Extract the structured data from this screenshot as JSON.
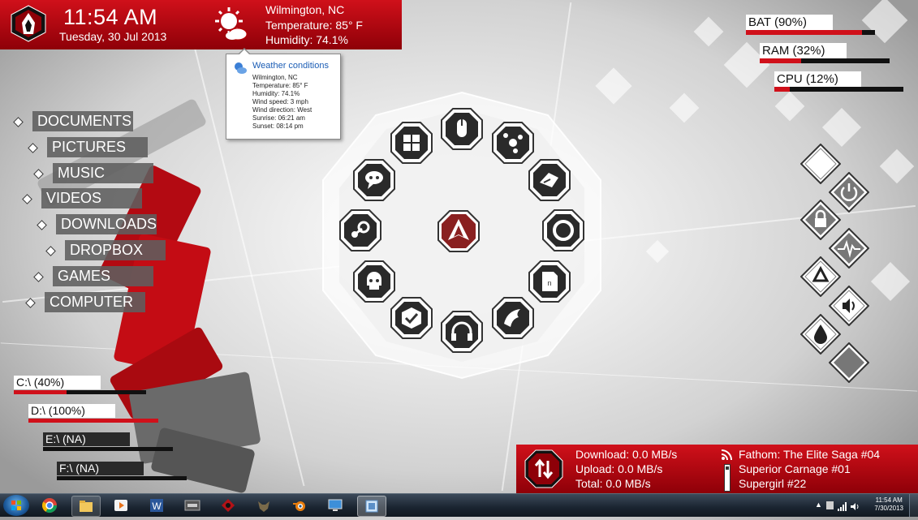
{
  "clock": {
    "time": "11:54 AM",
    "date": "Tuesday, 30 Jul 2013"
  },
  "weather": {
    "location": "Wilmington, NC",
    "temperature": "Temperature: 85° F",
    "humidity": "Humidity: 74.1%",
    "icon": "sun-cloud-icon"
  },
  "tooltip": {
    "title": "Weather conditions",
    "lines": [
      "Wilmington, NC",
      "Temperature: 85° F",
      "Humidity: 74.1%",
      "Wind speed: 3 mph",
      "Wind direction: West",
      "Sunrise: 06:21 am",
      "Sunset: 08:14 pm"
    ]
  },
  "menu": {
    "items": [
      {
        "label": "DOCUMENTS"
      },
      {
        "label": "PICTURES"
      },
      {
        "label": "MUSIC"
      },
      {
        "label": "VIDEOS"
      },
      {
        "label": "DOWNLOADS"
      },
      {
        "label": "DROPBOX"
      },
      {
        "label": "GAMES"
      },
      {
        "label": "COMPUTER"
      }
    ]
  },
  "drives": [
    {
      "label": "C:\\  (40%)",
      "fill": 0.4
    },
    {
      "label": "D:\\  (100%)",
      "fill": 1.0
    },
    {
      "label": "E:\\  (NA)",
      "fill": 0
    },
    {
      "label": "F:\\  (NA)",
      "fill": 0
    }
  ],
  "system": [
    {
      "label": "BAT (90%)",
      "fill": 0.9
    },
    {
      "label": "RAM (32%)",
      "fill": 0.32
    },
    {
      "label": "CPU (12%)",
      "fill": 0.12
    }
  ],
  "launcher": {
    "center_icon": "assassins-logo-icon",
    "items": [
      "mouse-icon",
      "share-icon",
      "hands-icon",
      "origin-icon",
      "document-icon",
      "eagle-icon",
      "headphones-icon",
      "check-icon",
      "skull-icon",
      "steam-icon",
      "skull-chat-icon",
      "apps-icon"
    ]
  },
  "power": {
    "items": [
      "blank-icon",
      "power-icon",
      "lock-icon",
      "pulse-icon",
      "recycle-icon",
      "volume-icon",
      "drop-icon",
      "blank-icon"
    ]
  },
  "network": {
    "download": "Download: 0.0 MB/s",
    "upload": "Upload: 0.0 MB/s",
    "total": "Total: 0.0 MB/s"
  },
  "feeds": [
    "Fathom: The Elite Saga #04",
    "Superior Carnage #01",
    "Supergirl #22"
  ],
  "taskbar": {
    "apps": [
      "chrome-icon",
      "explorer-icon",
      "media-player-icon",
      "word-icon",
      "app-jk-icon",
      "game-icon",
      "wolf-icon",
      "blender-icon",
      "remote-icon",
      "taskbar-active-icon"
    ],
    "tray_time": "11:54 AM",
    "tray_date": "7/30/2013"
  },
  "colors": {
    "accent": "#d0101a",
    "dark": "#111111",
    "panel": "#5f5f5f"
  }
}
